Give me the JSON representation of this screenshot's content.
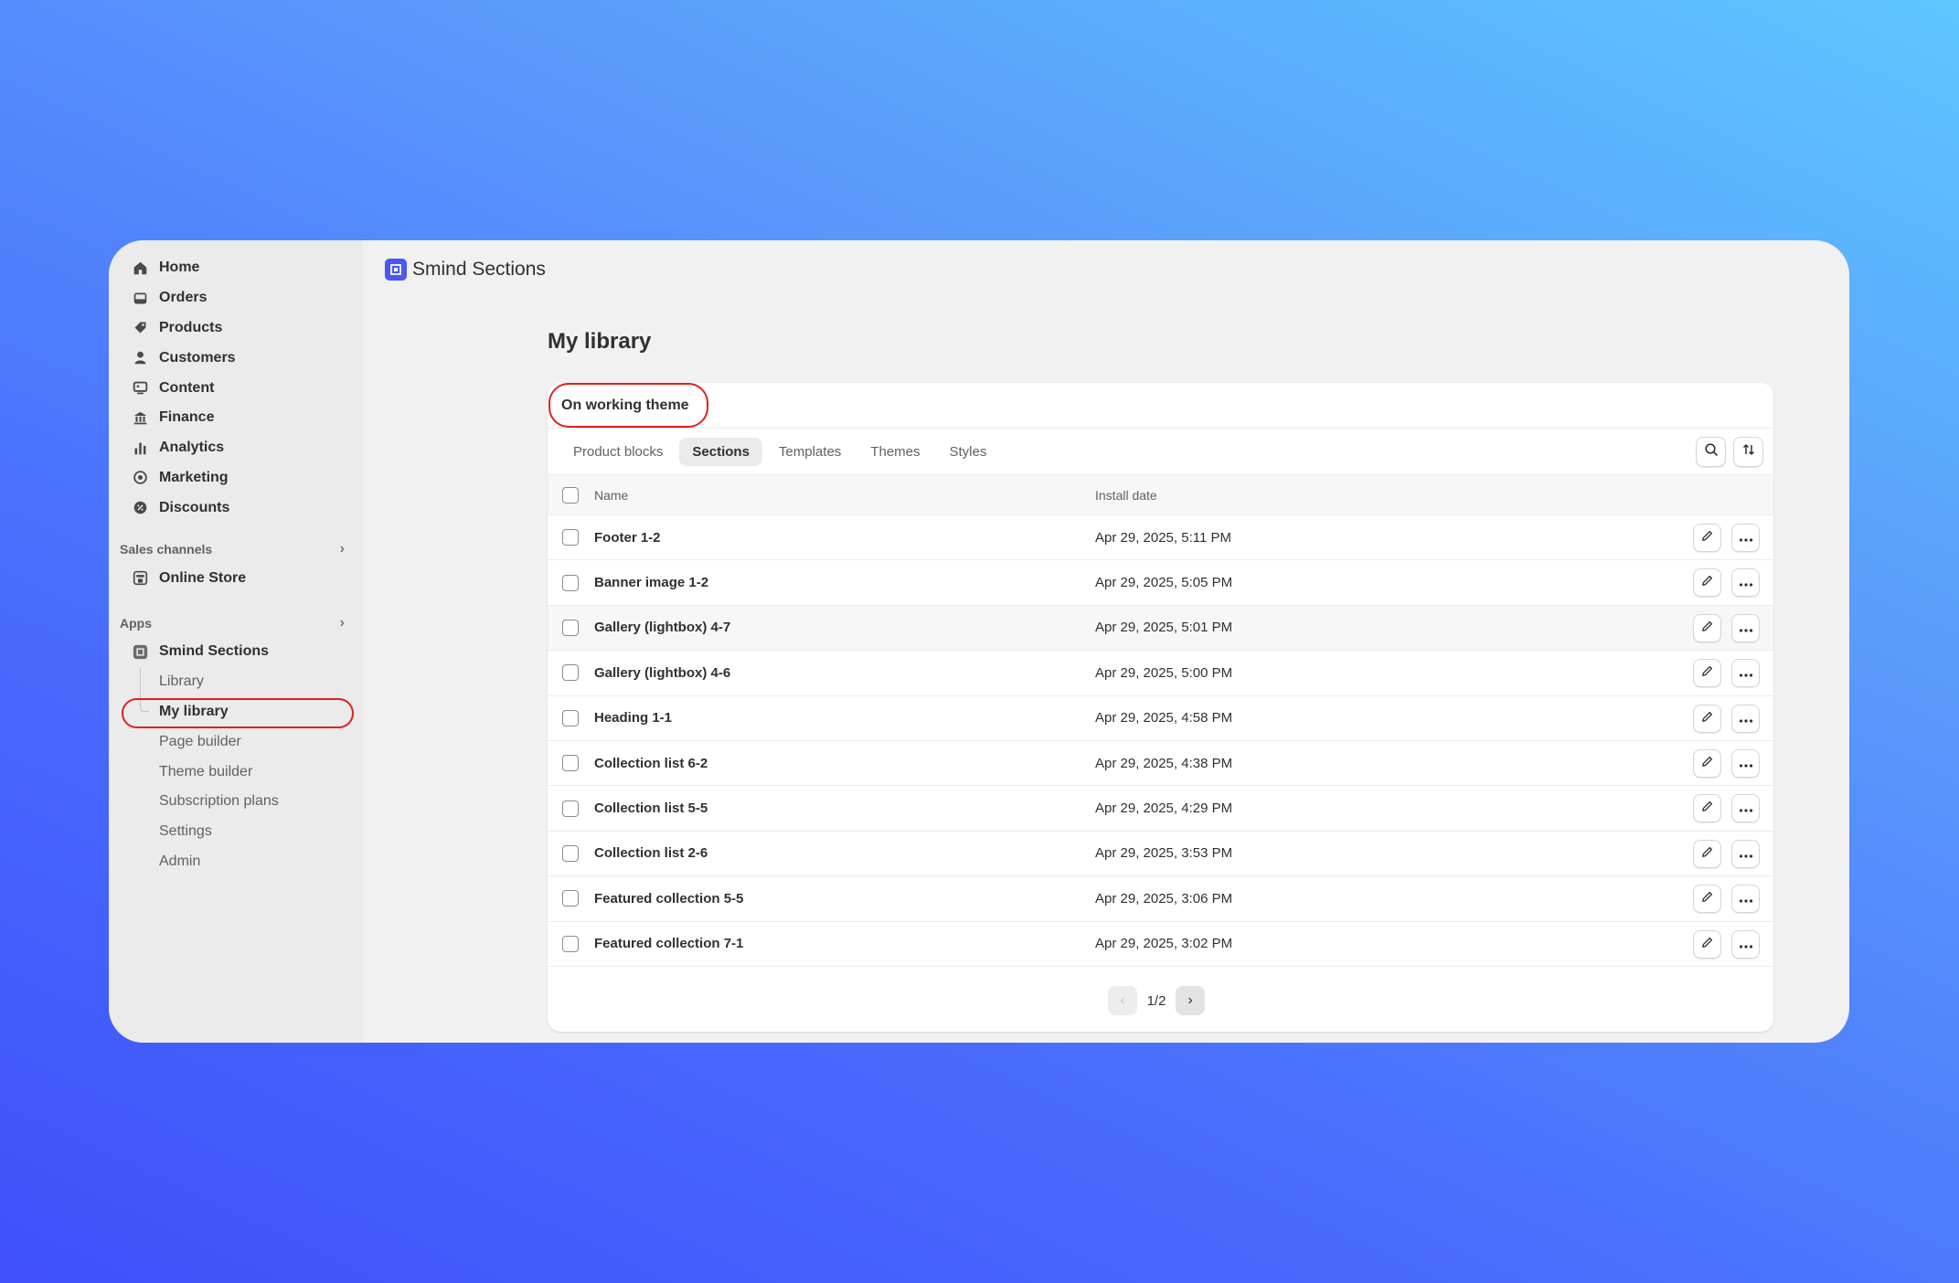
{
  "sidebar": {
    "nav": [
      {
        "label": "Home",
        "icon": "home-icon"
      },
      {
        "label": "Orders",
        "icon": "inbox-icon"
      },
      {
        "label": "Products",
        "icon": "tag-icon"
      },
      {
        "label": "Customers",
        "icon": "person-icon"
      },
      {
        "label": "Content",
        "icon": "content-icon"
      },
      {
        "label": "Finance",
        "icon": "bank-icon"
      },
      {
        "label": "Analytics",
        "icon": "bar-chart-icon"
      },
      {
        "label": "Marketing",
        "icon": "target-icon"
      },
      {
        "label": "Discounts",
        "icon": "discount-icon"
      }
    ],
    "sales_channels": {
      "header": "Sales channels",
      "items": [
        {
          "label": "Online Store",
          "icon": "store-icon"
        }
      ]
    },
    "apps": {
      "header": "Apps",
      "app": {
        "label": "Smind Sections",
        "icon": "app-icon"
      },
      "sub_items": [
        "Library",
        "My library",
        "Page builder",
        "Theme builder",
        "Subscription plans",
        "Settings",
        "Admin"
      ]
    }
  },
  "header": {
    "app_title": "Smind Sections"
  },
  "page": {
    "title": "My library"
  },
  "card": {
    "filter_label": "On working theme",
    "tabs": [
      "Product blocks",
      "Sections",
      "Templates",
      "Themes",
      "Styles"
    ],
    "active_tab": "Sections",
    "columns": {
      "name": "Name",
      "date": "Install date"
    },
    "rows": [
      {
        "name": "Footer 1-2",
        "date": "Apr 29, 2025, 5:11 PM"
      },
      {
        "name": "Banner image 1-2",
        "date": "Apr 29, 2025, 5:05 PM"
      },
      {
        "name": "Gallery (lightbox) 4-7",
        "date": "Apr 29, 2025, 5:01 PM"
      },
      {
        "name": "Gallery (lightbox) 4-6",
        "date": "Apr 29, 2025, 5:00 PM"
      },
      {
        "name": "Heading 1-1",
        "date": "Apr 29, 2025, 4:58 PM"
      },
      {
        "name": "Collection list 6-2",
        "date": "Apr 29, 2025, 4:38 PM"
      },
      {
        "name": "Collection list 5-5",
        "date": "Apr 29, 2025, 4:29 PM"
      },
      {
        "name": "Collection list 2-6",
        "date": "Apr 29, 2025, 3:53 PM"
      },
      {
        "name": "Featured collection 5-5",
        "date": "Apr 29, 2025, 3:06 PM"
      },
      {
        "name": "Featured collection 7-1",
        "date": "Apr 29, 2025, 3:02 PM"
      }
    ],
    "pagination": {
      "label": "1/2"
    }
  },
  "colors": {
    "highlight": "#e0201c",
    "app_accent": "#4a56f5"
  }
}
